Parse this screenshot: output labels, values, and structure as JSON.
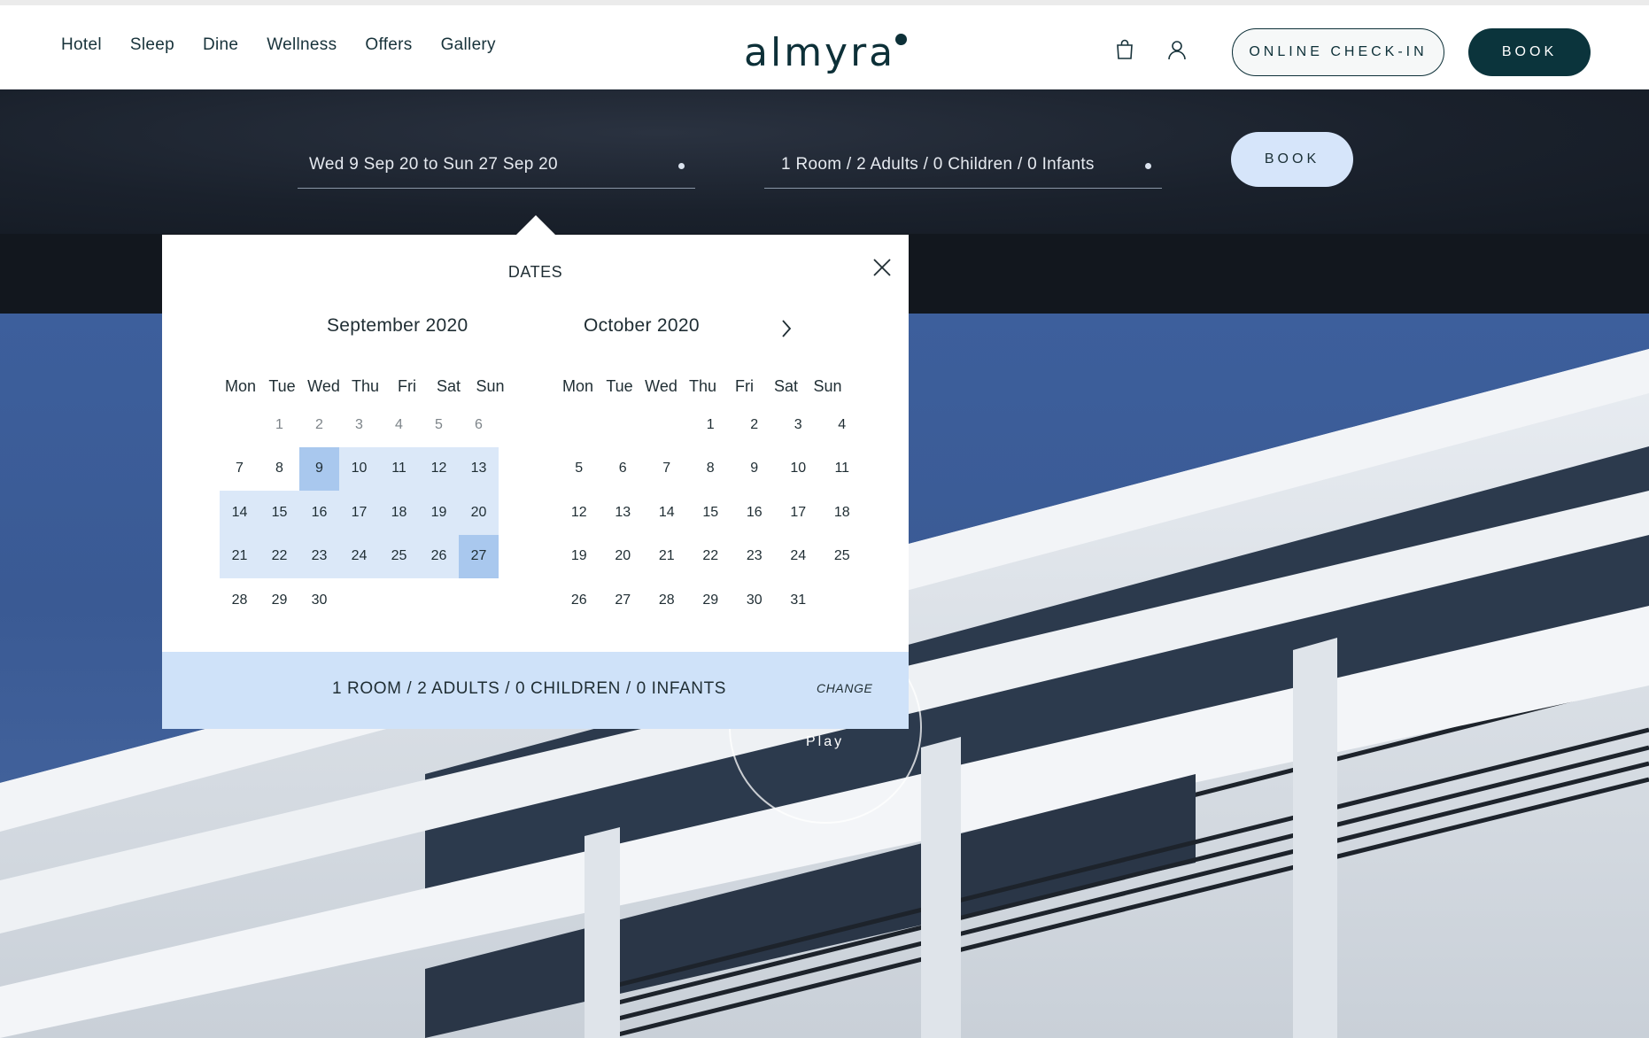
{
  "header": {
    "nav": [
      "Hotel",
      "Sleep",
      "Dine",
      "Wellness",
      "Offers",
      "Gallery"
    ],
    "logo": "almyra",
    "checkin_label": "ONLINE CHECK-IN",
    "book_label": "BOOK"
  },
  "booking_bar": {
    "dates_value": "Wed 9 Sep 20 to Sun 27 Sep 20",
    "guests_value": "1 Room / 2 Adults / 0 Children / 0 Infants",
    "book_label": "BOOK"
  },
  "picker": {
    "title": "DATES",
    "weekdays": [
      "Mon",
      "Tue",
      "Wed",
      "Thu",
      "Fri",
      "Sat",
      "Sun"
    ],
    "months": [
      {
        "title": "September 2020",
        "weeks": [
          [
            "",
            "1",
            "2",
            "3",
            "4",
            "5",
            "6"
          ],
          [
            "7",
            "8",
            "9",
            "10",
            "11",
            "12",
            "13"
          ],
          [
            "14",
            "15",
            "16",
            "17",
            "18",
            "19",
            "20"
          ],
          [
            "21",
            "22",
            "23",
            "24",
            "25",
            "26",
            "27"
          ],
          [
            "28",
            "29",
            "30",
            "",
            "",
            "",
            ""
          ]
        ],
        "past_days": [
          "1",
          "2",
          "3",
          "4",
          "5",
          "6"
        ],
        "selected_start": "9",
        "selected_end": "27"
      },
      {
        "title": "October 2020",
        "weeks": [
          [
            "",
            "",
            "",
            "1",
            "2",
            "3",
            "4"
          ],
          [
            "5",
            "6",
            "7",
            "8",
            "9",
            "10",
            "11"
          ],
          [
            "12",
            "13",
            "14",
            "15",
            "16",
            "17",
            "18"
          ],
          [
            "19",
            "20",
            "21",
            "22",
            "23",
            "24",
            "25"
          ],
          [
            "26",
            "27",
            "28",
            "29",
            "30",
            "31",
            ""
          ]
        ]
      }
    ],
    "footer_text": "1 ROOM / 2 ADULTS / 0 CHILDREN / 0 INFANTS",
    "change_label": "CHANGE"
  },
  "hero": {
    "play_label": "Play"
  },
  "colors": {
    "brand": "#0b343c",
    "range": "#dbe8f8",
    "selected": "#a9c8ee",
    "footer": "#cfe2f9"
  }
}
